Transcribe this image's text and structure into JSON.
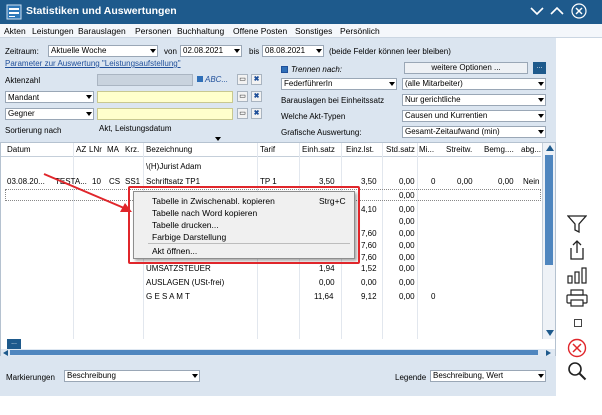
{
  "window": {
    "title": "Statistiken und Auswertungen"
  },
  "menu": [
    "Akten",
    "Leistungen",
    "Barauslagen",
    "Personen",
    "Buchhaltung",
    "Offene Posten",
    "Sonstiges",
    "Persönlich"
  ],
  "filters": {
    "zeitraum_label": "Zeitraum:",
    "zeitraum_value": "Aktuelle Woche",
    "von_label": "von",
    "von_value": "02.08.2021",
    "bis_label": "bis",
    "bis_value": "08.08.2021",
    "hint": "(beide Felder können leer bleiben)",
    "param_link": "Parameter zur Auswertung \"Leistungsaufstellung\"",
    "aktenzahl_label": "Aktenzahl",
    "abc_label": "ABC...",
    "mandant_label": "Mandant",
    "gegner_label": "Gegner",
    "sortierung_label": "Sortierung nach",
    "sortierung_value": "Akt, Leistungsdatum",
    "trennen_label": "Trennen nach:",
    "trennen_value": "FederführerIn",
    "mitarbeiter_value": "(alle Mitarbeiter)",
    "barauslagen_label": "Barauslagen bei Einheitssatz",
    "barauslagen_value": "Nur gerichtliche",
    "akttypen_label": "Welche Akt-Typen",
    "akttypen_value": "Causen und Kurrentien",
    "grafisch_label": "Grafische Auswertung:",
    "grafisch_value": "Gesamt-Zeitaufwand (min)",
    "weitere_label": "weitere Optionen ...",
    "dots": "..."
  },
  "table": {
    "headers": [
      "Datum",
      "AZ",
      "LNr",
      "MA",
      "Krz.",
      "Bezeichnung",
      "Tarif",
      "Einh.satz",
      "Einz.lst.",
      "Std.satz",
      "Mi...",
      "Streitw.",
      "Bemg....",
      "abg..."
    ],
    "row1": {
      "bezeichnung": "\\(H)Jurist Adam"
    },
    "row2": {
      "datum": "03.08.20...",
      "az": "TESTA...",
      "lnr": "10",
      "ma": "CS",
      "krz": "SS1",
      "bezeichnung": "Schriftsatz TP1",
      "tarif": "TP 1",
      "einh": "3,50",
      "einz": "3,50",
      "std": "0,00",
      "mi": "0",
      "streitw": "0,00",
      "bemg": "0,00",
      "abg": "Nein"
    },
    "std_col": [
      "0,00",
      "0,00",
      "0,00",
      "0,00",
      "0,00",
      "0,00"
    ],
    "einz_col": [
      "4,10",
      "7,60",
      "7,60",
      "7,60"
    ],
    "umsatz": {
      "label": "UMSATZSTEUER",
      "einh": "1,94",
      "einz": "1,52",
      "std": "0,00"
    },
    "auslagen": {
      "label": "AUSLAGEN (USt-frei)",
      "einh": "0,00",
      "einz": "0,00",
      "std": "0,00"
    },
    "gesamt": {
      "label": "G E S A M T",
      "einh": "11,64",
      "einz": "9,12",
      "std": "0,00",
      "mi": "0"
    },
    "nav_dots": "..."
  },
  "context_menu": {
    "items": [
      "Tabelle in Zwischenabl. kopieren",
      "Tabelle nach Word kopieren",
      "Tabelle drucken...",
      "Farbige Darstellung",
      "Akt öffnen..."
    ],
    "shortcut": "Strg+C"
  },
  "footer": {
    "markierungen_label": "Markierungen",
    "markierungen_value": "Beschreibung",
    "legende_label": "Legende",
    "legende_value": "Beschreibung, Wert"
  },
  "colors": {
    "titlebar": "#1e5a8c",
    "form_bg": "#dbe5f0",
    "highlight": "#ffffcc",
    "annotation_red": "#e0262b"
  }
}
